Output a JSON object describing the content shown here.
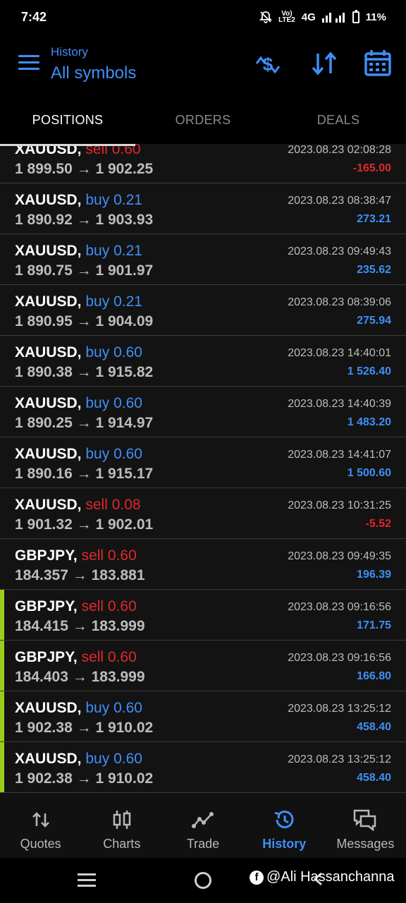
{
  "status_bar": {
    "time": "7:42",
    "network_top": "Vo)",
    "network_bottom": "LTE2",
    "network_type": "4G",
    "battery": "11%"
  },
  "header": {
    "subtitle": "History",
    "title": "All symbols",
    "icons": [
      "currency-exchange-icon",
      "sort-icon",
      "calendar-icon"
    ]
  },
  "tabs": [
    {
      "label": "POSITIONS",
      "active": true
    },
    {
      "label": "ORDERS",
      "active": false
    },
    {
      "label": "DEALS",
      "active": false
    }
  ],
  "deals": [
    {
      "symbol": "XAUUSD,",
      "side": "sell",
      "volume": "0.60",
      "open": "1 899.50",
      "close": "1 902.25",
      "time": "2023.08.23 02:08:28",
      "profit": "-165.00",
      "marked": false
    },
    {
      "symbol": "XAUUSD,",
      "side": "buy",
      "volume": "0.21",
      "open": "1 890.92",
      "close": "1 903.93",
      "time": "2023.08.23 08:38:47",
      "profit": "273.21",
      "marked": false
    },
    {
      "symbol": "XAUUSD,",
      "side": "buy",
      "volume": "0.21",
      "open": "1 890.75",
      "close": "1 901.97",
      "time": "2023.08.23 09:49:43",
      "profit": "235.62",
      "marked": false
    },
    {
      "symbol": "XAUUSD,",
      "side": "buy",
      "volume": "0.21",
      "open": "1 890.95",
      "close": "1 904.09",
      "time": "2023.08.23 08:39:06",
      "profit": "275.94",
      "marked": false
    },
    {
      "symbol": "XAUUSD,",
      "side": "buy",
      "volume": "0.60",
      "open": "1 890.38",
      "close": "1 915.82",
      "time": "2023.08.23 14:40:01",
      "profit": "1 526.40",
      "marked": false
    },
    {
      "symbol": "XAUUSD,",
      "side": "buy",
      "volume": "0.60",
      "open": "1 890.25",
      "close": "1 914.97",
      "time": "2023.08.23 14:40:39",
      "profit": "1 483.20",
      "marked": false
    },
    {
      "symbol": "XAUUSD,",
      "side": "buy",
      "volume": "0.60",
      "open": "1 890.16",
      "close": "1 915.17",
      "time": "2023.08.23 14:41:07",
      "profit": "1 500.60",
      "marked": false
    },
    {
      "symbol": "XAUUSD,",
      "side": "sell",
      "volume": "0.08",
      "open": "1 901.32",
      "close": "1 902.01",
      "time": "2023.08.23 10:31:25",
      "profit": "-5.52",
      "marked": false
    },
    {
      "symbol": "GBPJPY,",
      "side": "sell",
      "volume": "0.60",
      "open": "184.357",
      "close": "183.881",
      "time": "2023.08.23 09:49:35",
      "profit": "196.39",
      "marked": false
    },
    {
      "symbol": "GBPJPY,",
      "side": "sell",
      "volume": "0.60",
      "open": "184.415",
      "close": "183.999",
      "time": "2023.08.23 09:16:56",
      "profit": "171.75",
      "marked": true
    },
    {
      "symbol": "GBPJPY,",
      "side": "sell",
      "volume": "0.60",
      "open": "184.403",
      "close": "183.999",
      "time": "2023.08.23 09:16:56",
      "profit": "166.80",
      "marked": true
    },
    {
      "symbol": "XAUUSD,",
      "side": "buy",
      "volume": "0.60",
      "open": "1 902.38",
      "close": "1 910.02",
      "time": "2023.08.23 13:25:12",
      "profit": "458.40",
      "marked": true
    },
    {
      "symbol": "XAUUSD,",
      "side": "buy",
      "volume": "0.60",
      "open": "1 902.38",
      "close": "1 910.02",
      "time": "2023.08.23 13:25:12",
      "profit": "458.40",
      "marked": true
    }
  ],
  "arrow": "→",
  "bottom_nav": [
    {
      "label": "Quotes",
      "icon": "quotes-icon",
      "active": false
    },
    {
      "label": "Charts",
      "icon": "charts-icon",
      "active": false
    },
    {
      "label": "Trade",
      "icon": "trade-icon",
      "active": false
    },
    {
      "label": "History",
      "icon": "history-icon",
      "active": true
    },
    {
      "label": "Messages",
      "icon": "messages-icon",
      "active": false
    }
  ],
  "watermark": {
    "logo": "f",
    "text": "@Ali Hassanchanna"
  },
  "colors": {
    "accent": "#3f8ff7",
    "sell": "#e0282a",
    "marker": "#9ccc1a"
  }
}
